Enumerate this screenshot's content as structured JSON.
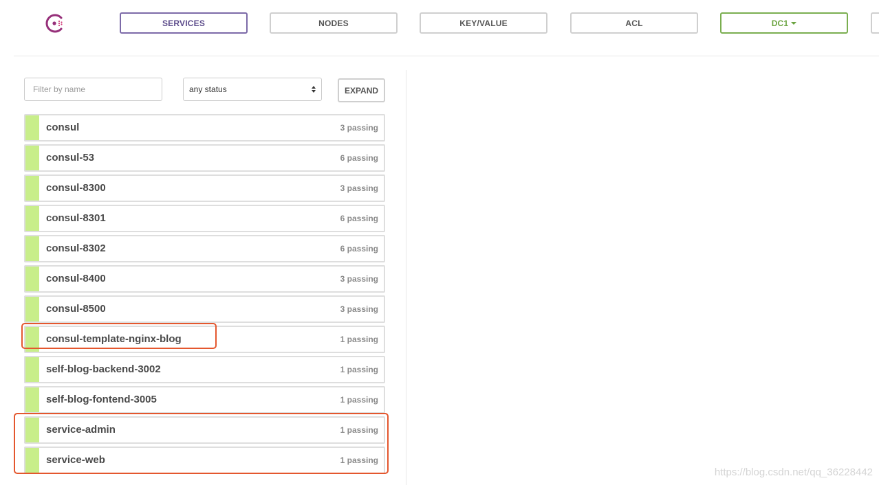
{
  "nav": {
    "services": "SERVICES",
    "nodes": "NODES",
    "keyvalue": "KEY/VALUE",
    "acl": "ACL",
    "datacenter": "DC1"
  },
  "filters": {
    "name_placeholder": "Filter by name",
    "status_selected": "any status",
    "expand_label": "EXPAND"
  },
  "services": [
    {
      "name": "consul",
      "checks": "3 passing"
    },
    {
      "name": "consul-53",
      "checks": "6 passing"
    },
    {
      "name": "consul-8300",
      "checks": "3 passing"
    },
    {
      "name": "consul-8301",
      "checks": "6 passing"
    },
    {
      "name": "consul-8302",
      "checks": "6 passing"
    },
    {
      "name": "consul-8400",
      "checks": "3 passing"
    },
    {
      "name": "consul-8500",
      "checks": "3 passing"
    },
    {
      "name": "consul-template-nginx-blog",
      "checks": "1 passing"
    },
    {
      "name": "self-blog-backend-3002",
      "checks": "1 passing"
    },
    {
      "name": "self-blog-fontend-3005",
      "checks": "1 passing"
    },
    {
      "name": "service-admin",
      "checks": "1 passing"
    },
    {
      "name": "service-web",
      "checks": "1 passing"
    }
  ],
  "colors": {
    "passing": "#c8ee8a",
    "active_nav": "#7c6aa8",
    "datacenter": "#7aae4f",
    "highlight": "#e4572e"
  },
  "watermark": "https://blog.csdn.net/qq_36228442"
}
